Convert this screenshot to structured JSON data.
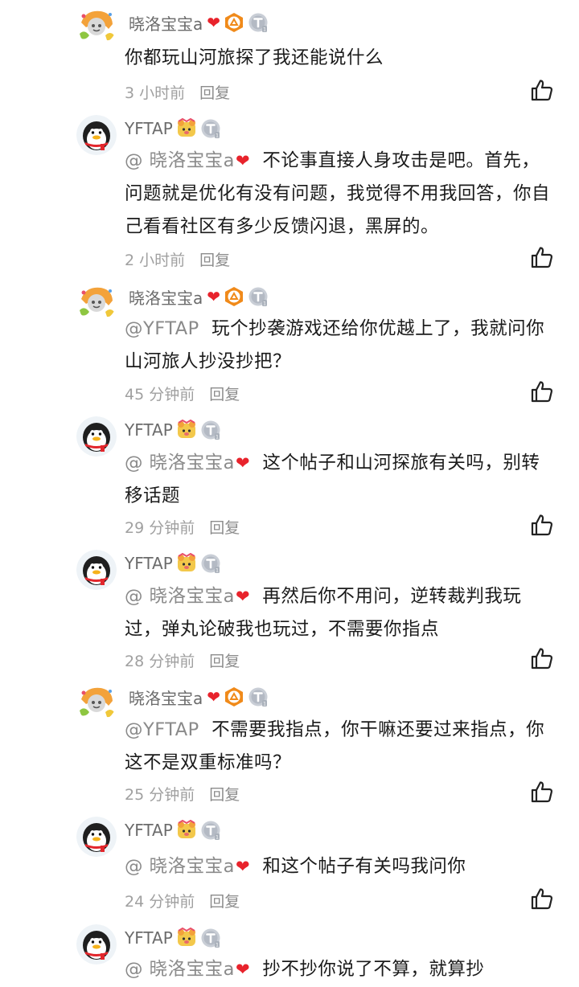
{
  "colors": {
    "heart": "#e8232c",
    "name": "#6b6b6b",
    "meta": "#a0a0a0",
    "mention": "#8a8a8a"
  },
  "comments": [
    {
      "user": "晓洛宝宝a",
      "avatar": "sticker-avatar",
      "badges": [
        "level-badge-icon",
        "t-badge-icon"
      ],
      "mention": "",
      "text": "你都玩山河旅探了我还能说什么",
      "time": "3 小时前",
      "reply": "回复"
    },
    {
      "user": "YFTAP",
      "avatar": "penguin-avatar",
      "badges": [
        "bear-badge-icon",
        "t-badge-icon"
      ],
      "mention": "@ 晓洛宝宝a",
      "text": "不论事直接人身攻击是吧。首先，问题就是优化有没有问题，我觉得不用我回答，你自己看看社区有多少反馈闪退，黑屏的。",
      "time": "2 小时前",
      "reply": "回复"
    },
    {
      "user": "晓洛宝宝a",
      "avatar": "sticker-avatar",
      "badges": [
        "level-badge-icon",
        "t-badge-icon"
      ],
      "mention": "@YFTAP",
      "text": "玩个抄袭游戏还给你优越上了，我就问你山河旅人抄没抄把？",
      "time": "45 分钟前",
      "reply": "回复"
    },
    {
      "user": "YFTAP",
      "avatar": "penguin-avatar",
      "badges": [
        "bear-badge-icon",
        "t-badge-icon"
      ],
      "mention": "@ 晓洛宝宝a",
      "text": "这个帖子和山河探旅有关吗，别转移话题",
      "time": "29 分钟前",
      "reply": "回复"
    },
    {
      "user": "YFTAP",
      "avatar": "penguin-avatar",
      "badges": [
        "bear-badge-icon",
        "t-badge-icon"
      ],
      "mention": "@ 晓洛宝宝a",
      "text": "再然后你不用问，逆转裁判我玩过，弹丸论破我也玩过，不需要你指点",
      "time": "28 分钟前",
      "reply": "回复"
    },
    {
      "user": "晓洛宝宝a",
      "avatar": "sticker-avatar",
      "badges": [
        "level-badge-icon",
        "t-badge-icon"
      ],
      "mention": "@YFTAP",
      "text": "不需要我指点，你干嘛还要过来指点，你这不是双重标准吗？",
      "time": "25 分钟前",
      "reply": "回复"
    },
    {
      "user": "YFTAP",
      "avatar": "penguin-avatar",
      "badges": [
        "bear-badge-icon",
        "t-badge-icon"
      ],
      "mention": "@ 晓洛宝宝a",
      "text": "和这个帖子有关吗我问你",
      "time": "24 分钟前",
      "reply": "回复"
    },
    {
      "user": "YFTAP",
      "avatar": "penguin-avatar",
      "badges": [
        "bear-badge-icon",
        "t-badge-icon"
      ],
      "mention": "@ 晓洛宝宝a",
      "text": "抄不抄你说了不算，就算抄",
      "time": "",
      "reply": ""
    }
  ]
}
